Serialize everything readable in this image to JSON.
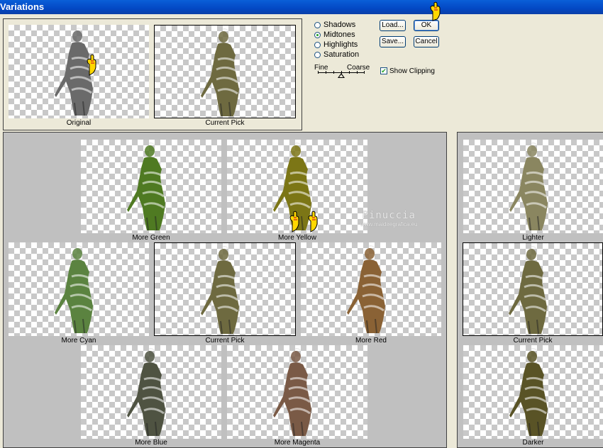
{
  "window": {
    "title": "Variations"
  },
  "top_preview": {
    "original": {
      "caption": "Original"
    },
    "current": {
      "caption": "Current Pick"
    }
  },
  "tone": {
    "options": [
      {
        "label": "Shadows",
        "selected": false
      },
      {
        "label": "Midtones",
        "selected": true
      },
      {
        "label": "Highlights",
        "selected": false
      },
      {
        "label": "Saturation",
        "selected": false
      }
    ]
  },
  "slider": {
    "fine_label": "Fine",
    "coarse_label": "Coarse",
    "level": 0.5
  },
  "buttons": {
    "load": "Load...",
    "save": "Save...",
    "ok": "OK",
    "cancel": "Cancel"
  },
  "show_clipping": {
    "label": "Show Clipping",
    "checked": true
  },
  "variations": {
    "more_green": "More Green",
    "more_yellow": "More Yellow",
    "more_cyan": "More Cyan",
    "current_pick": "Current Pick",
    "more_red": "More Red",
    "more_blue": "More Blue",
    "more_magenta": "More Magenta"
  },
  "brightness": {
    "lighter": "Lighter",
    "current_pick": "Current Pick",
    "darker": "Darker"
  },
  "watermark": {
    "name": "Pinuccia",
    "site": "www.maidiregrafica.eu"
  },
  "tints": {
    "original": "#6a6a6a",
    "current": "#6e6a40",
    "green": "#4f7a22",
    "yellow": "#7c7616",
    "cyan": "#5b8340",
    "red": "#8a6235",
    "blue": "#4f5342",
    "magenta": "#7a5a46",
    "lighter": "#8a8660",
    "darker": "#595326"
  }
}
